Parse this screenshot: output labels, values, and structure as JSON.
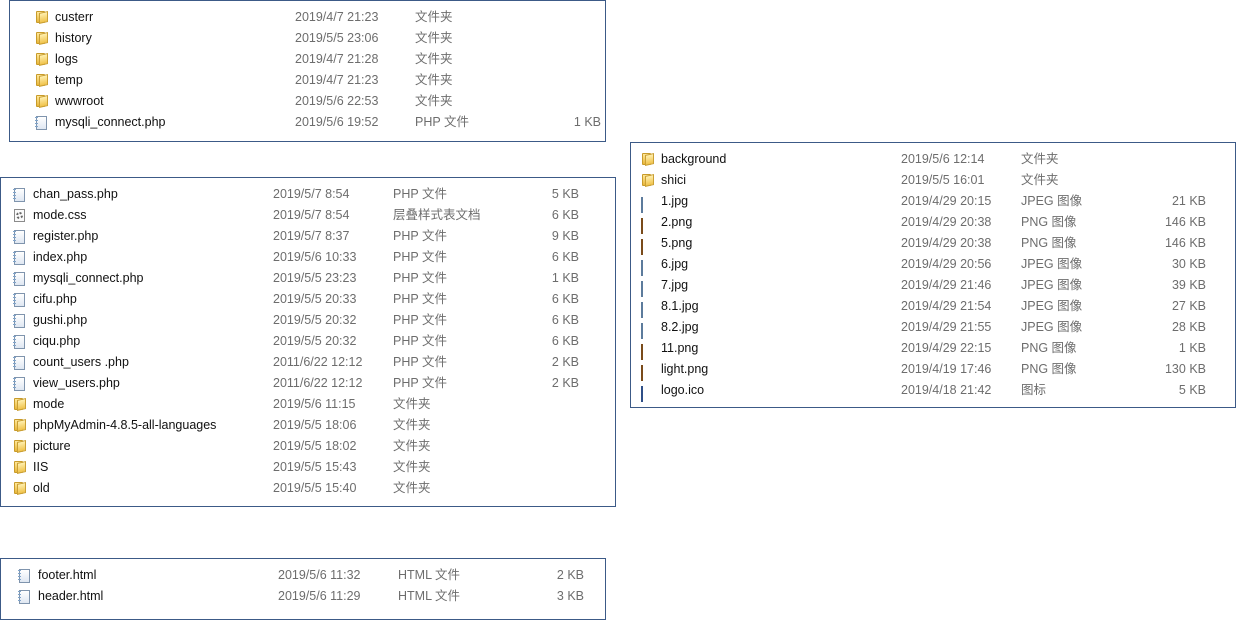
{
  "panels": [
    {
      "id": "panel-top-left",
      "rows": [
        {
          "icon": "folder-icon",
          "name": "custerr",
          "date": "2019/4/7 21:23",
          "type": "文件夹",
          "size": ""
        },
        {
          "icon": "folder-icon",
          "name": "history",
          "date": "2019/5/5 23:06",
          "type": "文件夹",
          "size": ""
        },
        {
          "icon": "folder-icon",
          "name": "logs",
          "date": "2019/4/7 21:28",
          "type": "文件夹",
          "size": ""
        },
        {
          "icon": "folder-icon",
          "name": "temp",
          "date": "2019/4/7 21:23",
          "type": "文件夹",
          "size": ""
        },
        {
          "icon": "folder-icon",
          "name": "wwwroot",
          "date": "2019/5/6 22:53",
          "type": "文件夹",
          "size": ""
        },
        {
          "icon": "php-file-icon",
          "name": "mysqli_connect.php",
          "date": "2019/5/6 19:52",
          "type": "PHP 文件",
          "size": "1 KB"
        }
      ]
    },
    {
      "id": "panel-middle-left",
      "rows": [
        {
          "icon": "php-file-icon",
          "name": "chan_pass.php",
          "date": "2019/5/7 8:54",
          "type": "PHP 文件",
          "size": "5 KB"
        },
        {
          "icon": "css-file-icon",
          "name": "mode.css",
          "date": "2019/5/7 8:54",
          "type": "层叠样式表文档",
          "size": "6 KB"
        },
        {
          "icon": "php-file-icon",
          "name": "register.php",
          "date": "2019/5/7 8:37",
          "type": "PHP 文件",
          "size": "9 KB"
        },
        {
          "icon": "php-file-icon",
          "name": "index.php",
          "date": "2019/5/6 10:33",
          "type": "PHP 文件",
          "size": "6 KB"
        },
        {
          "icon": "php-file-icon",
          "name": "mysqli_connect.php",
          "date": "2019/5/5 23:23",
          "type": "PHP 文件",
          "size": "1 KB"
        },
        {
          "icon": "php-file-icon",
          "name": "cifu.php",
          "date": "2019/5/5 20:33",
          "type": "PHP 文件",
          "size": "6 KB"
        },
        {
          "icon": "php-file-icon",
          "name": "gushi.php",
          "date": "2019/5/5 20:32",
          "type": "PHP 文件",
          "size": "6 KB"
        },
        {
          "icon": "php-file-icon",
          "name": "ciqu.php",
          "date": "2019/5/5 20:32",
          "type": "PHP 文件",
          "size": "6 KB"
        },
        {
          "icon": "php-file-icon",
          "name": "count_users .php",
          "date": "2011/6/22 12:12",
          "type": "PHP 文件",
          "size": "2 KB"
        },
        {
          "icon": "php-file-icon",
          "name": "view_users.php",
          "date": "2011/6/22 12:12",
          "type": "PHP 文件",
          "size": "2 KB"
        },
        {
          "icon": "folder-icon",
          "name": "mode",
          "date": "2019/5/6 11:15",
          "type": "文件夹",
          "size": ""
        },
        {
          "icon": "folder-icon",
          "name": "phpMyAdmin-4.8.5-all-languages",
          "date": "2019/5/5 18:06",
          "type": "文件夹",
          "size": ""
        },
        {
          "icon": "folder-icon",
          "name": "picture",
          "date": "2019/5/5 18:02",
          "type": "文件夹",
          "size": ""
        },
        {
          "icon": "folder-icon",
          "name": "IIS",
          "date": "2019/5/5 15:43",
          "type": "文件夹",
          "size": ""
        },
        {
          "icon": "folder-icon",
          "name": "old",
          "date": "2019/5/5 15:40",
          "type": "文件夹",
          "size": ""
        }
      ]
    },
    {
      "id": "panel-bottom-left",
      "rows": [
        {
          "icon": "html-file-icon",
          "name": "footer.html",
          "date": "2019/5/6 11:32",
          "type": "HTML 文件",
          "size": "2 KB"
        },
        {
          "icon": "html-file-icon",
          "name": "header.html",
          "date": "2019/5/6 11:29",
          "type": "HTML 文件",
          "size": "3 KB"
        }
      ]
    },
    {
      "id": "panel-right",
      "rows": [
        {
          "icon": "folder-icon",
          "name": "background",
          "date": "2019/5/6 12:14",
          "type": "文件夹",
          "size": ""
        },
        {
          "icon": "folder-icon",
          "name": "shici",
          "date": "2019/5/5 16:01",
          "type": "文件夹",
          "size": ""
        },
        {
          "icon": "jpeg-image-icon",
          "name": "1.jpg",
          "date": "2019/4/29 20:15",
          "type": "JPEG 图像",
          "size": "21 KB"
        },
        {
          "icon": "png-image-icon",
          "name": "2.png",
          "date": "2019/4/29 20:38",
          "type": "PNG 图像",
          "size": "146 KB"
        },
        {
          "icon": "png-image-icon",
          "name": "5.png",
          "date": "2019/4/29 20:38",
          "type": "PNG 图像",
          "size": "146 KB"
        },
        {
          "icon": "jpeg-image-icon",
          "name": "6.jpg",
          "date": "2019/4/29 20:56",
          "type": "JPEG 图像",
          "size": "30 KB"
        },
        {
          "icon": "jpeg-image-icon",
          "name": "7.jpg",
          "date": "2019/4/29 21:46",
          "type": "JPEG 图像",
          "size": "39 KB"
        },
        {
          "icon": "jpeg-image-icon",
          "name": "8.1.jpg",
          "date": "2019/4/29 21:54",
          "type": "JPEG 图像",
          "size": "27 KB"
        },
        {
          "icon": "jpeg-image-icon",
          "name": "8.2.jpg",
          "date": "2019/4/29 21:55",
          "type": "JPEG 图像",
          "size": "28 KB"
        },
        {
          "icon": "png-image-icon",
          "name": "11.png",
          "date": "2019/4/29 22:15",
          "type": "PNG 图像",
          "size": "1 KB"
        },
        {
          "icon": "png-image-icon",
          "name": "light.png",
          "date": "2019/4/19 17:46",
          "type": "PNG 图像",
          "size": "130 KB"
        },
        {
          "icon": "ico-file-icon",
          "name": "logo.ico",
          "date": "2019/4/18 21:42",
          "type": "图标",
          "size": "5 KB"
        }
      ]
    }
  ]
}
